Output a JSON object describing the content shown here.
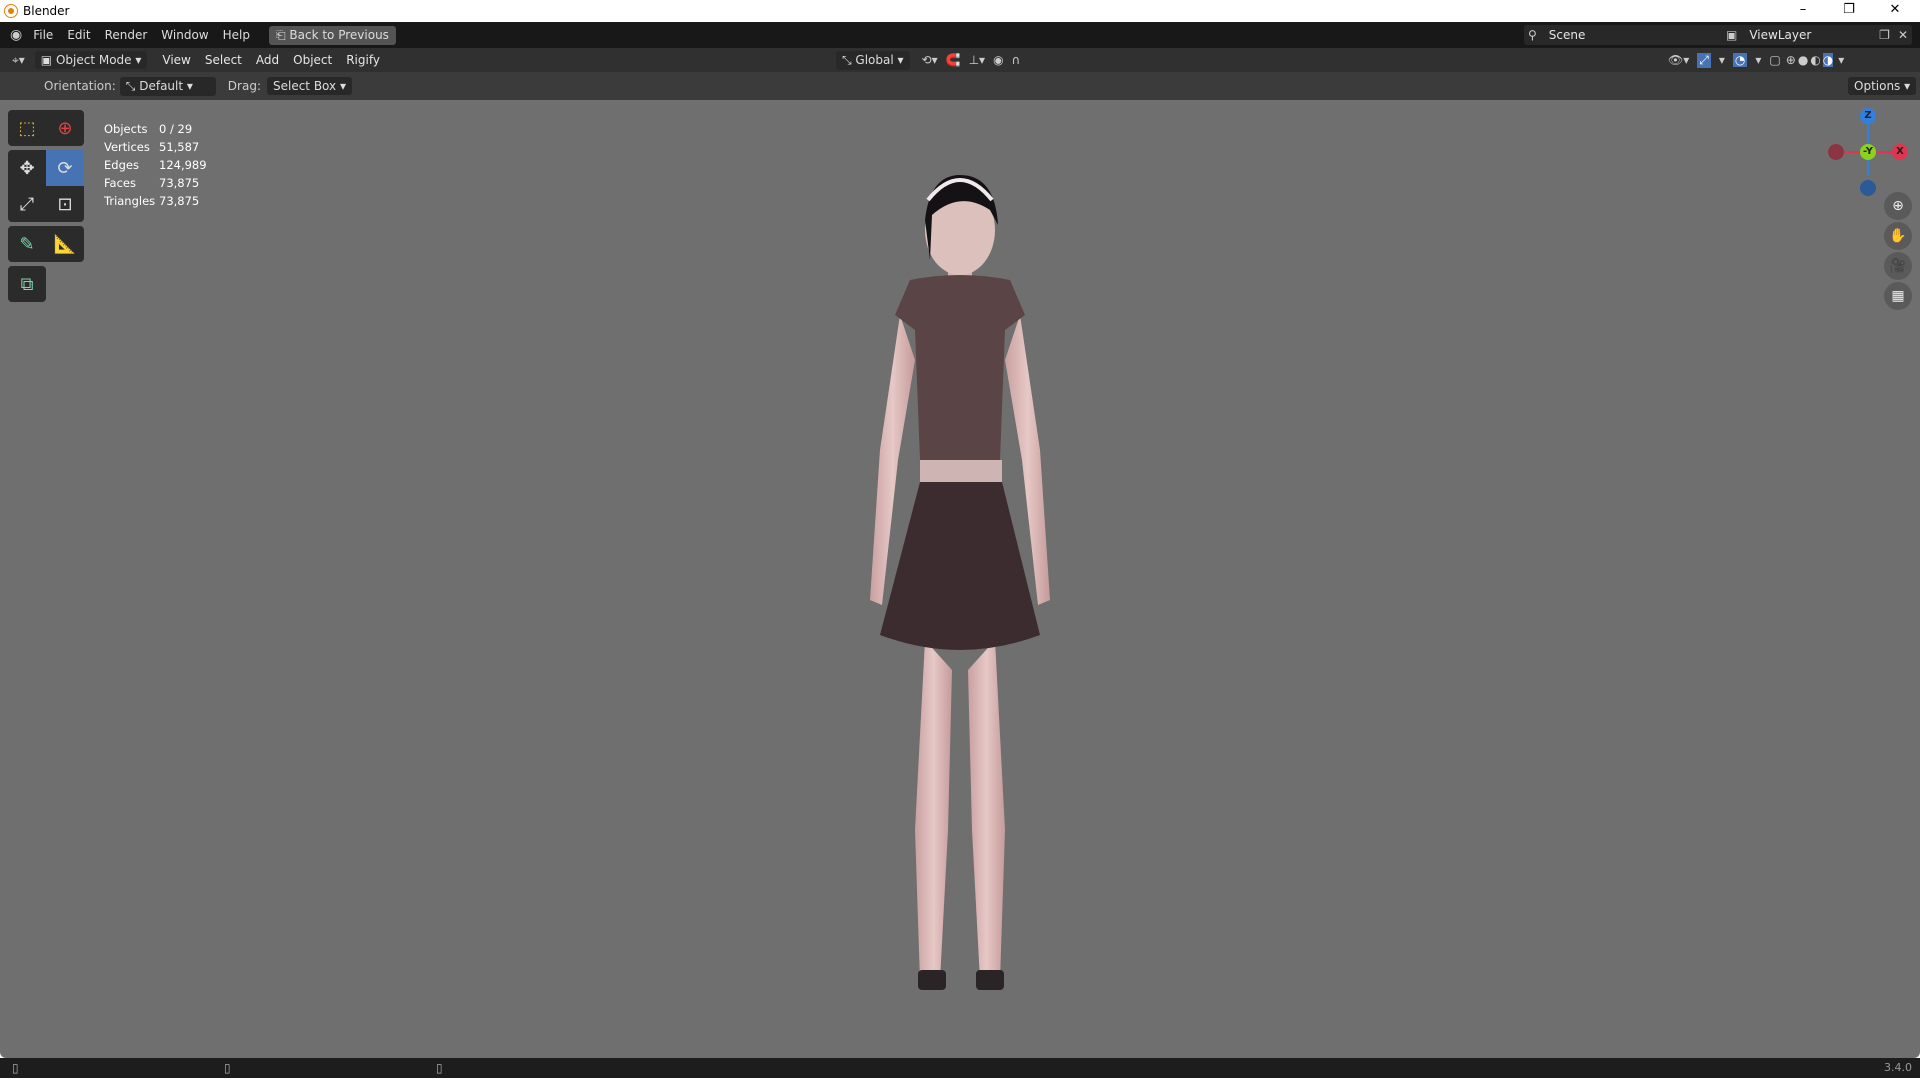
{
  "window": {
    "title": "Blender",
    "minimize": "–",
    "restore": "❐",
    "close": "✕"
  },
  "menu": {
    "items": [
      "File",
      "Edit",
      "Render",
      "Window",
      "Help"
    ],
    "back_button": "Back to Previous",
    "scene": "Scene",
    "view_layer": "ViewLayer"
  },
  "header": {
    "mode": "Object Mode",
    "menus": [
      "View",
      "Select",
      "Add",
      "Object",
      "Rigify"
    ],
    "transform_orientation": "Global"
  },
  "tool_settings": {
    "orientation_label": "Orientation:",
    "orientation_value": "Default",
    "drag_label": "Drag:",
    "drag_value": "Select Box",
    "options": "Options"
  },
  "stats": [
    {
      "k": "Objects",
      "v": "0 / 29"
    },
    {
      "k": "Vertices",
      "v": "51,587"
    },
    {
      "k": "Edges",
      "v": "124,989"
    },
    {
      "k": "Faces",
      "v": "73,875"
    },
    {
      "k": "Triangles",
      "v": "73,875"
    }
  ],
  "gizmo": {
    "z": "Z",
    "y": "-Y",
    "x": "X"
  },
  "status": {
    "version": "3.4.0"
  },
  "colors": {
    "accent": "#4772b3",
    "x": "#e0354f",
    "y": "#8bd11e",
    "z": "#2f80e0"
  }
}
